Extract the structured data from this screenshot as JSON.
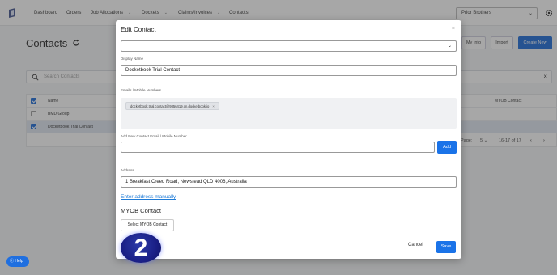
{
  "nav": {
    "items": [
      {
        "label": "Dashboard"
      },
      {
        "label": "Orders"
      },
      {
        "label": "Job Allocations"
      },
      {
        "label": "Dockets"
      },
      {
        "label": "Claims/Invoices"
      },
      {
        "label": "Contacts"
      }
    ],
    "company": "Prior Brothers"
  },
  "page": {
    "title": "Contacts",
    "buttons": {
      "my_info": "My Info",
      "import": "Import",
      "create_new": "Create New"
    },
    "search_placeholder": "Search Contacts",
    "table": {
      "headers": {
        "name": "Name",
        "myob": "MYOB Contact"
      },
      "rows": [
        {
          "name": "BMD Group",
          "checked": false
        },
        {
          "name": "Docketbook Trial Contact",
          "checked": true
        }
      ],
      "pager": {
        "label": "Page:",
        "per_page": "5",
        "range": "16-17 of 17"
      }
    }
  },
  "modal": {
    "title": "Edit Contact",
    "display_name_label": "Display Name",
    "display_name_value": "Docketbook Trial Contact",
    "emails_label": "Emails / Mobile Numbers",
    "email_chip": "docketbook.trial.contact@9856419.on.docketbook.io",
    "add_new_label": "Add New Contact Email / Mobile Number",
    "add_button": "Add",
    "address_label": "Address",
    "address_value": "1 Breakfast Creed Road, Newstead QLD 4006, Australia",
    "enter_manually_link": "Enter address manually",
    "myob_heading": "MYOB Contact",
    "select_myob_button": "Select MYOB Contact",
    "cancel": "Cancel",
    "save": "Save"
  },
  "badge": "2",
  "help": "Help",
  "colors": {
    "primary": "#1a73e8",
    "badge": "#1a1f86"
  }
}
